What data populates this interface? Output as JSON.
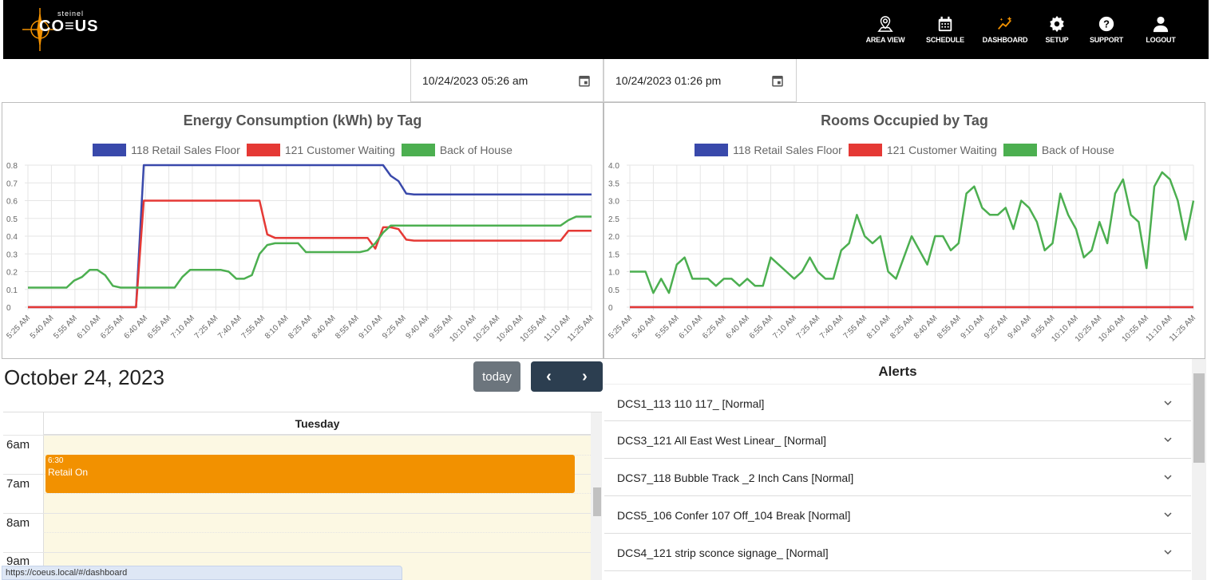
{
  "app": {
    "logo_text": "CO≡US",
    "logo_sub": "steinel"
  },
  "nav": [
    {
      "label": "AREA VIEW",
      "icon": "map-pin-icon"
    },
    {
      "label": "SCHEDULE",
      "icon": "calendar-icon"
    },
    {
      "label": "DASHBOARD",
      "icon": "dashboard-sparkle-icon"
    },
    {
      "label": "SETUP",
      "icon": "gear-icon"
    },
    {
      "label": "SUPPORT",
      "icon": "help-icon"
    },
    {
      "label": "LOGOUT",
      "icon": "user-icon"
    }
  ],
  "dates": {
    "start": "10/24/2023 05:26 am",
    "end": "10/24/2023 01:26 pm"
  },
  "colors": {
    "topbar": "#000000",
    "series_blue": "#3949ab",
    "series_red": "#e53935",
    "series_green": "#4caf50",
    "event": "#f29100",
    "active_nav": "#f29100"
  },
  "chart_data": [
    {
      "type": "line",
      "title": "Energy Consumption (kWh) by Tag",
      "legend_position": "top",
      "grid": true,
      "ylim": [
        0,
        0.8
      ],
      "yticks": [
        "0",
        "0.1",
        "0.2",
        "0.3",
        "0.4",
        "0.5",
        "0.6",
        "0.7",
        "0.8"
      ],
      "xticks": [
        "5:25 AM",
        "5:40 AM",
        "5:55 AM",
        "6:10 AM",
        "6:25 AM",
        "6:40 AM",
        "6:55 AM",
        "7:10 AM",
        "7:25 AM",
        "7:40 AM",
        "7:55 AM",
        "8:10 AM",
        "8:25 AM",
        "8:40 AM",
        "8:55 AM",
        "9:10 AM",
        "9:25 AM",
        "9:40 AM",
        "9:55 AM",
        "10:10 AM",
        "10:25 AM",
        "10:40 AM",
        "10:55 AM",
        "11:10 AM",
        "11:25 AM"
      ],
      "series": [
        {
          "name": "118 Retail Sales Floor",
          "color": "#3949ab",
          "values": [
            0,
            0,
            0,
            0,
            0,
            0,
            0,
            0,
            0,
            0,
            0,
            0,
            0,
            0,
            0,
            0.8,
            0.8,
            0.8,
            0.8,
            0.8,
            0.8,
            0.8,
            0.8,
            0.8,
            0.8,
            0.8,
            0.8,
            0.8,
            0.8,
            0.8,
            0.8,
            0.8,
            0.8,
            0.8,
            0.8,
            0.8,
            0.8,
            0.8,
            0.8,
            0.8,
            0.8,
            0.8,
            0.8,
            0.8,
            0.8,
            0.8,
            0.8,
            0.74,
            0.71,
            0.64,
            0.635,
            0.635,
            0.635,
            0.635,
            0.635,
            0.635,
            0.635,
            0.635,
            0.635,
            0.635,
            0.635,
            0.635,
            0.635,
            0.635,
            0.635,
            0.635,
            0.635,
            0.635,
            0.635,
            0.635,
            0.635,
            0.635,
            0.635,
            0.635
          ]
        },
        {
          "name": "121 Customer Waiting",
          "color": "#e53935",
          "values": [
            0,
            0,
            0,
            0,
            0,
            0,
            0,
            0,
            0,
            0,
            0,
            0,
            0,
            0,
            0,
            0.6,
            0.6,
            0.6,
            0.6,
            0.6,
            0.6,
            0.6,
            0.6,
            0.6,
            0.6,
            0.6,
            0.6,
            0.6,
            0.6,
            0.6,
            0.6,
            0.41,
            0.39,
            0.39,
            0.39,
            0.39,
            0.39,
            0.39,
            0.39,
            0.39,
            0.39,
            0.39,
            0.39,
            0.39,
            0.39,
            0.33,
            0.45,
            0.45,
            0.44,
            0.38,
            0.375,
            0.375,
            0.375,
            0.375,
            0.375,
            0.375,
            0.375,
            0.375,
            0.375,
            0.375,
            0.375,
            0.375,
            0.375,
            0.375,
            0.375,
            0.375,
            0.375,
            0.375,
            0.375,
            0.375,
            0.43,
            0.43,
            0.43,
            0.43
          ]
        },
        {
          "name": "Back of House",
          "color": "#4caf50",
          "values": [
            0.11,
            0.11,
            0.11,
            0.11,
            0.11,
            0.11,
            0.15,
            0.17,
            0.21,
            0.21,
            0.18,
            0.12,
            0.11,
            0.11,
            0.11,
            0.11,
            0.11,
            0.11,
            0.11,
            0.11,
            0.17,
            0.21,
            0.21,
            0.21,
            0.21,
            0.21,
            0.2,
            0.16,
            0.16,
            0.18,
            0.3,
            0.35,
            0.36,
            0.36,
            0.36,
            0.36,
            0.31,
            0.31,
            0.31,
            0.31,
            0.31,
            0.31,
            0.31,
            0.31,
            0.32,
            0.36,
            0.42,
            0.46,
            0.46,
            0.46,
            0.46,
            0.46,
            0.46,
            0.46,
            0.46,
            0.46,
            0.46,
            0.46,
            0.46,
            0.46,
            0.46,
            0.46,
            0.46,
            0.46,
            0.46,
            0.46,
            0.46,
            0.46,
            0.46,
            0.46,
            0.49,
            0.51,
            0.51,
            0.51
          ]
        }
      ]
    },
    {
      "type": "line",
      "title": "Rooms Occupied by Tag",
      "legend_position": "top",
      "grid": true,
      "ylim": [
        0,
        4.0
      ],
      "yticks": [
        "0",
        "0.5",
        "1.0",
        "1.5",
        "2.0",
        "2.5",
        "3.0",
        "3.5",
        "4.0"
      ],
      "xticks": [
        "5:25 AM",
        "5:40 AM",
        "5:55 AM",
        "6:10 AM",
        "6:25 AM",
        "6:40 AM",
        "6:55 AM",
        "7:10 AM",
        "7:25 AM",
        "7:40 AM",
        "7:55 AM",
        "8:10 AM",
        "8:25 AM",
        "8:40 AM",
        "8:55 AM",
        "9:10 AM",
        "9:25 AM",
        "9:40 AM",
        "9:55 AM",
        "10:10 AM",
        "10:25 AM",
        "10:40 AM",
        "10:55 AM",
        "11:10 AM",
        "11:25 AM"
      ],
      "series": [
        {
          "name": "118 Retail Sales Floor",
          "color": "#3949ab",
          "values": [
            0,
            0,
            0,
            0,
            0,
            0,
            0,
            0,
            0,
            0,
            0,
            0,
            0,
            0,
            0,
            0,
            0,
            0,
            0,
            0,
            0,
            0,
            0,
            0,
            0,
            0,
            0,
            0,
            0,
            0,
            0,
            0,
            0,
            0,
            0,
            0,
            0,
            0,
            0,
            0,
            0,
            0,
            0,
            0,
            0,
            0,
            0,
            0,
            0,
            0,
            0,
            0,
            0,
            0,
            0,
            0,
            0,
            0,
            0,
            0,
            0,
            0,
            0,
            0,
            0,
            0,
            0,
            0,
            0,
            0,
            0,
            0,
            0,
            0,
            0,
            0,
            0,
            0,
            0,
            0,
            0,
            0,
            0
          ]
        },
        {
          "name": "121 Customer Waiting",
          "color": "#e53935",
          "values": [
            0,
            0,
            0,
            0,
            0,
            0,
            0,
            0,
            0,
            0,
            0,
            0,
            0,
            0,
            0,
            0,
            0,
            0,
            0,
            0,
            0,
            0,
            0,
            0,
            0,
            0,
            0,
            0,
            0,
            0,
            0,
            0,
            0,
            0,
            0,
            0,
            0,
            0,
            0,
            0,
            0,
            0,
            0,
            0,
            0,
            0,
            0,
            0,
            0,
            0,
            0,
            0,
            0,
            0,
            0,
            0,
            0,
            0,
            0,
            0,
            0,
            0,
            0,
            0,
            0,
            0,
            0,
            0,
            0,
            0,
            0,
            0,
            0,
            0,
            0,
            0,
            0,
            0,
            0,
            0,
            0,
            0,
            0
          ]
        },
        {
          "name": "Back of House",
          "color": "#4caf50",
          "values": [
            1.0,
            1.0,
            1.0,
            0.4,
            0.8,
            0.4,
            1.2,
            1.4,
            0.8,
            0.8,
            0.8,
            0.6,
            0.8,
            0.8,
            0.6,
            0.8,
            0.6,
            0.6,
            1.4,
            1.2,
            1.0,
            0.8,
            1.0,
            1.4,
            1.0,
            0.8,
            0.8,
            1.6,
            1.8,
            2.6,
            2.0,
            1.8,
            2.0,
            1.0,
            0.8,
            1.4,
            2.0,
            1.6,
            1.2,
            2.0,
            2.0,
            1.6,
            1.8,
            3.2,
            3.4,
            2.8,
            2.6,
            2.6,
            2.8,
            2.2,
            3.0,
            2.8,
            2.4,
            1.6,
            1.8,
            3.2,
            2.6,
            2.2,
            1.4,
            1.6,
            2.4,
            1.8,
            3.2,
            3.6,
            2.6,
            2.4,
            1.1,
            3.4,
            3.8,
            3.6,
            3.0,
            1.9,
            3.0
          ]
        }
      ]
    }
  ],
  "calendar": {
    "title": "October 24, 2023",
    "today_label": "today",
    "prev_label": "‹",
    "next_label": "›",
    "day_header": "Tuesday",
    "hours": [
      "6am",
      "7am",
      "8am",
      "9am"
    ],
    "event": {
      "time": "6:30",
      "title": "Retail On"
    }
  },
  "alerts": {
    "title": "Alerts",
    "items": [
      "DCS1_113 110 117_ [Normal]",
      "DCS3_121 All East West Linear_ [Normal]",
      "DCS7_118 Bubble Track _2 Inch Cans [Normal]",
      "DCS5_106 Confer 107 Off_104 Break [Normal]",
      "DCS4_121 strip sconce signage_ [Normal]"
    ]
  },
  "status_url": "https://coeus.local/#/dashboard"
}
